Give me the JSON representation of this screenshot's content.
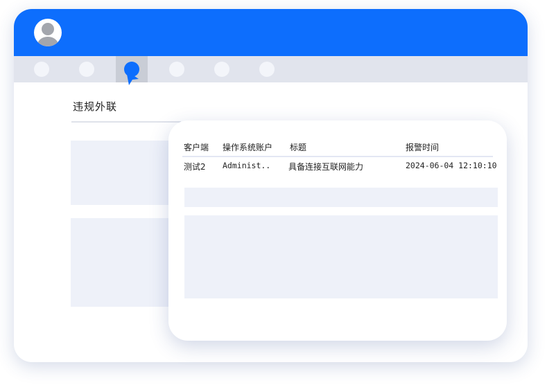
{
  "nav": {
    "tabs": [
      {
        "icon": "circle-icon",
        "active": false
      },
      {
        "icon": "circle-icon",
        "active": false
      },
      {
        "icon": "circle-icon",
        "active": true
      },
      {
        "icon": "circle-icon",
        "active": false
      },
      {
        "icon": "circle-icon",
        "active": false
      },
      {
        "icon": "circle-icon",
        "active": false
      }
    ]
  },
  "section": {
    "title": "违规外联"
  },
  "table": {
    "headers": [
      "客户端",
      "操作系统账户",
      "标题",
      "报警时间"
    ],
    "rows": [
      [
        "测试2",
        "Administ..",
        "具备连接互联网能力",
        "2024-06-04 12:10:10"
      ]
    ]
  },
  "colors": {
    "accent": "#0d6efd",
    "tabbar": "#e1e4ed",
    "placeholder": "#eef1f9"
  }
}
